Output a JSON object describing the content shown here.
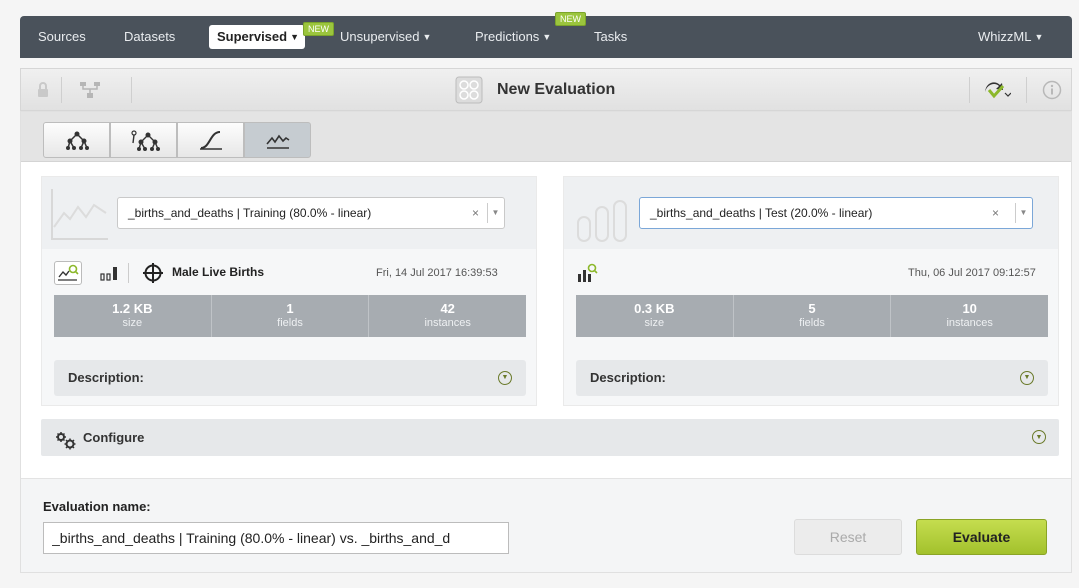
{
  "nav": {
    "items": [
      {
        "label": "Sources"
      },
      {
        "label": "Datasets"
      },
      {
        "label": "Supervised"
      },
      {
        "label": "Unsupervised"
      },
      {
        "label": "Predictions"
      },
      {
        "label": "Tasks"
      }
    ],
    "badge": "NEW",
    "right": "WhizzML"
  },
  "title": "New Evaluation",
  "left": {
    "select_value": "_births_and_deaths | Training (80.0% - linear)",
    "model_name": "Male Live Births",
    "date": "Fri, 14 Jul 2017 16:39:53",
    "stats": [
      {
        "value": "1.2 KB",
        "label": "size"
      },
      {
        "value": "1",
        "label": "fields"
      },
      {
        "value": "42",
        "label": "instances"
      }
    ],
    "description_label": "Description:"
  },
  "right": {
    "select_value": "_births_and_deaths | Test (20.0% - linear)",
    "date": "Thu, 06 Jul 2017 09:12:57",
    "stats": [
      {
        "value": "0.3 KB",
        "label": "size"
      },
      {
        "value": "5",
        "label": "fields"
      },
      {
        "value": "10",
        "label": "instances"
      }
    ],
    "description_label": "Description:"
  },
  "configure_label": "Configure",
  "evaluation": {
    "name_label": "Evaluation name:",
    "name_value": "_births_and_deaths | Training (80.0% - linear) vs. _births_and_d",
    "reset_label": "Reset",
    "evaluate_label": "Evaluate"
  },
  "select_clear": "×",
  "colors": {
    "nav_bg": "#4a525b",
    "accent_green": "#a3c12c",
    "stats_bg": "#a7acb1"
  }
}
